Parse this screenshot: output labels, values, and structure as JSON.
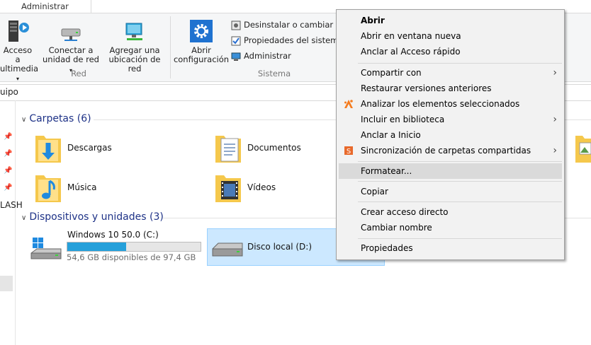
{
  "tab": {
    "label": "Administrar"
  },
  "ribbon": {
    "multimedia": {
      "line1": "Acceso a",
      "line2": "ultimedia"
    },
    "map_drive": {
      "line1": "Conectar a",
      "line2": "unidad de red"
    },
    "add_location": {
      "line1": "Agregar una",
      "line2": "ubicación de red"
    },
    "open_settings": {
      "line1": "Abrir",
      "line2": "configuración"
    },
    "uninstall": "Desinstalar o cambiar un",
    "sys_props": "Propiedades del sistema",
    "manage": "Administrar",
    "group_red": "Red",
    "group_sistema": "Sistema"
  },
  "address": {
    "text": "uipo"
  },
  "nav": {
    "flash_label": "LASH"
  },
  "folders": {
    "header": "Carpetas (6)",
    "items": [
      {
        "name": "Descargas"
      },
      {
        "name": "Documentos"
      },
      {
        "name": "Música"
      },
      {
        "name": "Vídeos"
      }
    ]
  },
  "devices": {
    "header": "Dispositivos y unidades (3)",
    "drive_c": {
      "name": "Windows 10 50.0 (C:)",
      "free": "54,6 GB disponibles de 97,4 GB",
      "used_fraction": 0.44
    },
    "drive_d": {
      "name": "Disco local (D:)"
    }
  },
  "context_menu": {
    "items": [
      {
        "label": "Abrir"
      },
      {
        "label": "Abrir en ventana nueva"
      },
      {
        "label": "Anclar al Acceso rápido"
      },
      {
        "label": "Compartir con"
      },
      {
        "label": "Restaurar versiones anteriores"
      },
      {
        "label": "Analizar los elementos seleccionados"
      },
      {
        "label": "Incluir en biblioteca"
      },
      {
        "label": "Anclar a Inicio"
      },
      {
        "label": "Sincronización de carpetas compartidas"
      },
      {
        "label": "Formatear..."
      },
      {
        "label": "Copiar"
      },
      {
        "label": "Crear acceso directo"
      },
      {
        "label": "Cambiar nombre"
      },
      {
        "label": "Propiedades"
      }
    ]
  },
  "colors": {
    "accent": "#26a0da",
    "selection": "#cce8ff",
    "menu_bg": "#f2f2f2",
    "menu_highlight": "#dadada",
    "section_header": "#1e3287",
    "avast_orange": "#f57c1f"
  }
}
